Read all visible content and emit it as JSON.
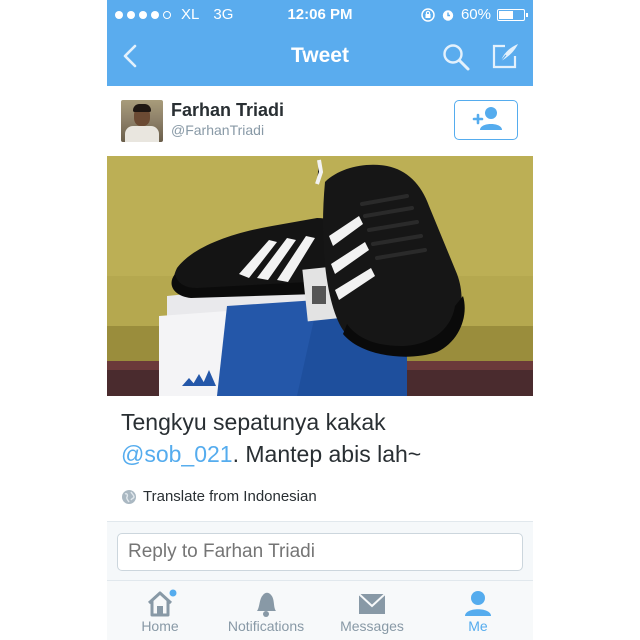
{
  "status_bar": {
    "carrier": "XL",
    "network": "3G",
    "time": "12:06 PM",
    "battery": "60%",
    "battery_level": 0.6,
    "signal_bars": 4
  },
  "nav": {
    "title": "Tweet",
    "back_icon": "chevron-left-icon",
    "search_icon": "search-icon",
    "compose_icon": "compose-icon"
  },
  "tweet": {
    "author_name": "Farhan Triadi",
    "author_handle": "@FarhanTriadi",
    "follow_icon": "add-user-icon",
    "text_before_mention": "Tengkyu sepatunya kakak",
    "mention": "@sob_021",
    "text_after_mention": ". Mantep abis lah~",
    "translate_label": "Translate from Indonesian"
  },
  "reply": {
    "placeholder": "Reply to Farhan Triadi"
  },
  "tabs": [
    {
      "label": "Home",
      "icon": "home-icon",
      "active": false,
      "has_dot": true
    },
    {
      "label": "Notifications",
      "icon": "bell-icon",
      "active": false
    },
    {
      "label": "Messages",
      "icon": "envelope-icon",
      "active": false
    },
    {
      "label": "Me",
      "icon": "person-icon",
      "active": true
    }
  ],
  "colors": {
    "brand_blue": "#55acee",
    "header_blue": "#5aacee",
    "text_dark": "#292f33",
    "text_gray": "#8899a6"
  }
}
